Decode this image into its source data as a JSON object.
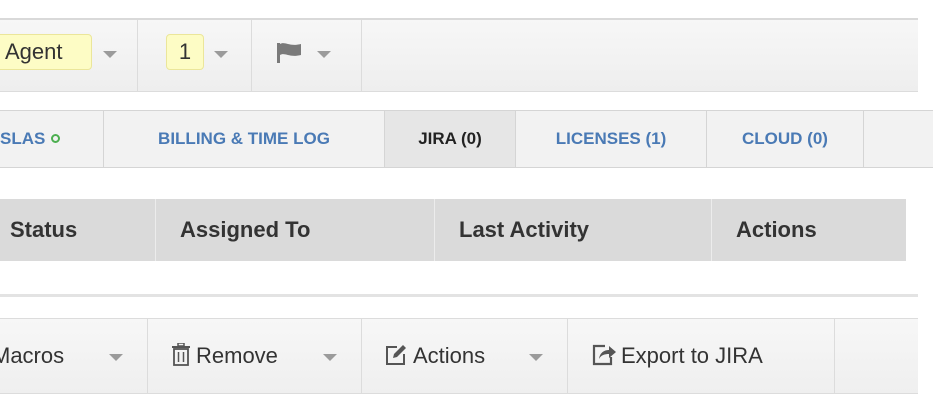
{
  "toolbar": {
    "agent_label": "Agent",
    "priority_label": "1"
  },
  "tabs": [
    {
      "label": "SLAS",
      "status": "green"
    },
    {
      "label": "BILLING & TIME LOG"
    },
    {
      "label": "JIRA (0)",
      "active": true
    },
    {
      "label": "LICENSES (1)"
    },
    {
      "label": "CLOUD (0)"
    }
  ],
  "table": {
    "columns": [
      "Status",
      "Assigned To",
      "Last Activity",
      "Actions"
    ]
  },
  "actionbar": {
    "macros_label": "Macros",
    "remove_label": "Remove",
    "actions_label": "Actions",
    "export_label": "Export to JIRA"
  },
  "colors": {
    "tab_link": "#4a7ab5",
    "highlight_chip": "#fdfcc5",
    "sla_ok": "#4caf50"
  },
  "icons": [
    "chevron-down-icon",
    "flag-icon",
    "trash-icon",
    "edit-icon",
    "share-icon"
  ]
}
